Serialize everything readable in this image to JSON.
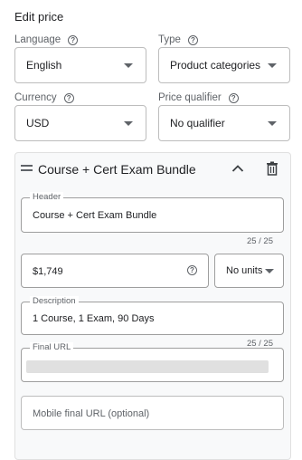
{
  "page": {
    "title": "Edit price"
  },
  "language": {
    "label": "Language",
    "value": "English"
  },
  "type": {
    "label": "Type",
    "value": "Product categories"
  },
  "currency": {
    "label": "Currency",
    "value": "USD"
  },
  "qualifier": {
    "label": "Price qualifier",
    "value": "No qualifier"
  },
  "item": {
    "title": "Course + Cert Exam Bundle",
    "header": {
      "label": "Header",
      "value": "Course + Cert Exam Bundle",
      "counter": "25 / 25"
    },
    "price": {
      "value": "$1,749"
    },
    "units": {
      "value": "No units"
    },
    "description": {
      "label": "Description",
      "value": "1 Course, 1 Exam, 90 Days",
      "counter": "25 / 25"
    },
    "final_url": {
      "label": "Final URL"
    },
    "mobile_url": {
      "placeholder": "Mobile final URL (optional)"
    }
  },
  "icons": [
    "help-icon",
    "dropdown-caret-icon",
    "drag-handle-icon",
    "chevron-up-icon",
    "delete-icon"
  ]
}
